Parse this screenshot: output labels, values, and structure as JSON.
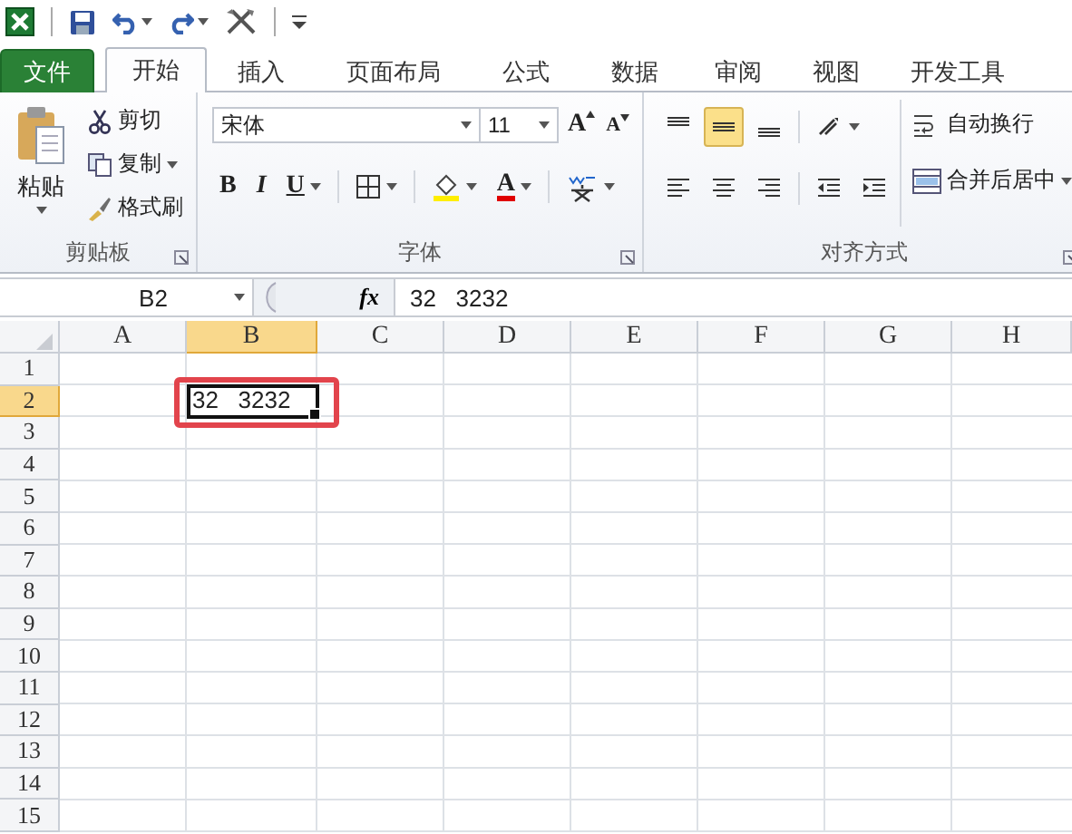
{
  "quick_access": [
    {
      "kind": "save"
    },
    {
      "kind": "undo"
    },
    {
      "kind": "redo"
    },
    {
      "kind": "tools"
    },
    {
      "kind": "customize"
    }
  ],
  "tabs": [
    {
      "label": "文件",
      "kind": "file",
      "selected": false
    },
    {
      "label": "开始",
      "kind": "tab",
      "selected": true
    },
    {
      "label": "插入",
      "kind": "tab",
      "selected": false
    },
    {
      "label": "页面布局",
      "kind": "tab",
      "selected": false
    },
    {
      "label": "公式",
      "kind": "tab",
      "selected": false
    },
    {
      "label": "数据",
      "kind": "tab",
      "selected": false
    },
    {
      "label": "审阅",
      "kind": "tab",
      "selected": false
    },
    {
      "label": "视图",
      "kind": "tab",
      "selected": false
    },
    {
      "label": "开发工具",
      "kind": "tab",
      "selected": false
    }
  ],
  "clipboard": {
    "paste": "粘贴",
    "cut": "剪切",
    "copy": "复制",
    "format_painter": "格式刷",
    "group_label": "剪贴板"
  },
  "font": {
    "font_name": "宋体",
    "font_size": "11",
    "grow": "A",
    "shrink": "A",
    "bold": "B",
    "italic": "I",
    "underline": "U",
    "font_color": "A",
    "group_label": "字体"
  },
  "alignment": {
    "buttons": [
      {
        "kind": "top",
        "selected": false
      },
      {
        "kind": "middle",
        "selected": true
      },
      {
        "kind": "bottom",
        "selected": false
      },
      {
        "kind": "orientation",
        "selected": false
      },
      {
        "kind": "left",
        "selected": false
      },
      {
        "kind": "center",
        "selected": false
      },
      {
        "kind": "right",
        "selected": false
      },
      {
        "kind": "outdent",
        "selected": false
      },
      {
        "kind": "indent",
        "selected": false
      }
    ],
    "wrap_text": "自动换行",
    "merge_center": "合并后居中",
    "group_label": "对齐方式"
  },
  "formula_bar": {
    "name_box": "B2",
    "fx": "fx",
    "content": "32   3232"
  },
  "sheet": {
    "columns": [
      {
        "label": "A",
        "selected": false
      },
      {
        "label": "B",
        "selected": true
      },
      {
        "label": "C",
        "selected": false
      },
      {
        "label": "D",
        "selected": false
      },
      {
        "label": "E",
        "selected": false
      },
      {
        "label": "F",
        "selected": false
      },
      {
        "label": "G",
        "selected": false
      },
      {
        "label": "H",
        "selected": false
      }
    ],
    "rows": [
      {
        "label": "1",
        "selected": false
      },
      {
        "label": "2",
        "selected": true
      },
      {
        "label": "3",
        "selected": false
      },
      {
        "label": "4",
        "selected": false
      },
      {
        "label": "5",
        "selected": false
      },
      {
        "label": "6",
        "selected": false
      },
      {
        "label": "7",
        "selected": false
      },
      {
        "label": "8",
        "selected": false
      },
      {
        "label": "9",
        "selected": false
      },
      {
        "label": "10",
        "selected": false
      },
      {
        "label": "11",
        "selected": false
      },
      {
        "label": "12",
        "selected": false
      },
      {
        "label": "13",
        "selected": false
      },
      {
        "label": "14",
        "selected": false
      },
      {
        "label": "15",
        "selected": false
      }
    ],
    "active_cell": {
      "value": "32   3232",
      "highlighted": true
    }
  }
}
